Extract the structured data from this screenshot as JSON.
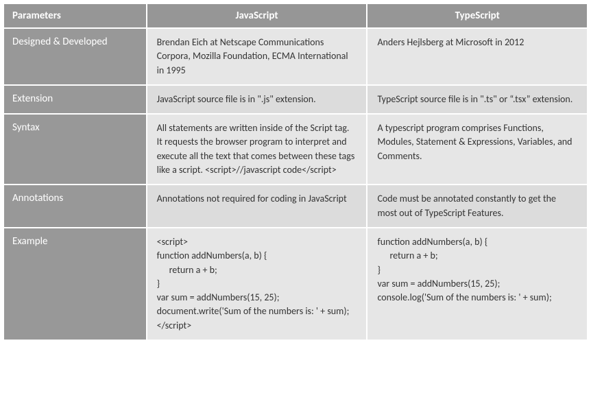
{
  "headers": {
    "col1": "Parameters",
    "col2": "JavaScript",
    "col3": "TypeScript"
  },
  "rows": [
    {
      "param": "Designed & Developed",
      "js": "Brendan Eich at Netscape Communications Corpora, Mozilla Foundation, ECMA International in 1995",
      "ts": "Anders Hejlsberg at Microsoft in 2012"
    },
    {
      "param": "Extension",
      "js": "JavaScript source file is in \".js\" extension.",
      "ts": "TypeScript source file is in \".ts\" or “.tsx” extension."
    },
    {
      "param": "Syntax",
      "js": "All statements are written inside of the Script tag. It requests the browser program to interpret and execute all the text that comes between these tags like a script. <script>//javascript code</script>",
      "ts": "A typescript program comprises Functions, Modules, Statement & Expressions, Variables, and Comments."
    },
    {
      "param": "Annotations",
      "js": "Annotations not required for coding in JavaScript",
      "ts": "Code must be annotated constantly to get the most out of TypeScript Features."
    },
    {
      "param": "Example",
      "js_lines": [
        {
          "text": "<script>",
          "indent": false
        },
        {
          "text": "function addNumbers(a, b) {",
          "indent": false
        },
        {
          "text": "return a + b;",
          "indent": true
        },
        {
          "text": "}",
          "indent": false
        },
        {
          "text": "var sum = addNumbers(15, 25);",
          "indent": false
        },
        {
          "text": "document.write('Sum of the numbers is: ' + sum);",
          "indent": false
        },
        {
          "text": "</script>",
          "indent": false
        }
      ],
      "ts_lines": [
        {
          "text": "function addNumbers(a, b) {",
          "indent": false
        },
        {
          "text": "return a + b;",
          "indent": true
        },
        {
          "text": "}",
          "indent": false
        },
        {
          "text": "var sum = addNumbers(15, 25);",
          "indent": false
        },
        {
          "text": "console.log('Sum of the numbers is: ' + sum);",
          "indent": false
        }
      ]
    }
  ]
}
